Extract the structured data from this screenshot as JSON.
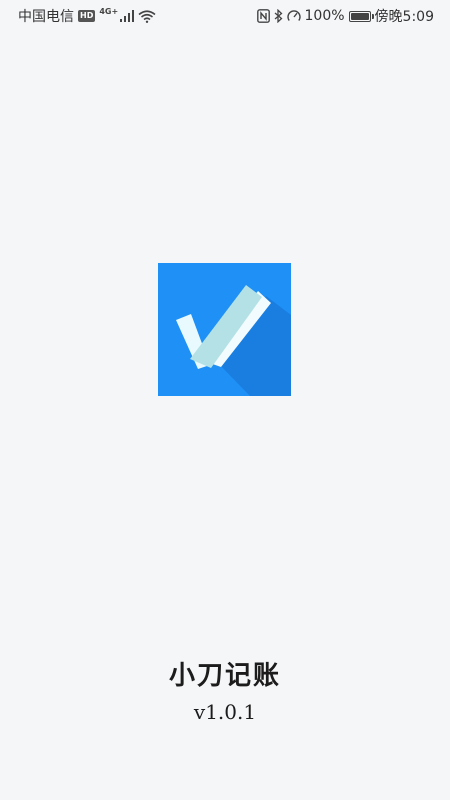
{
  "status_bar": {
    "carrier": "中国电信",
    "hd_badge": "HD",
    "network_type": "4G+",
    "battery_percent": "100%",
    "battery_level": 1.0,
    "time": "傍晚5:09",
    "icons": [
      "hd-icon",
      "signal-icon",
      "wifi-icon",
      "nfc-icon",
      "bluetooth-icon",
      "speed-icon",
      "battery-icon"
    ]
  },
  "splash": {
    "app_name": "小刀记账",
    "version": "v1.0.1",
    "logo_colors": {
      "background": "#1e90f6",
      "shadow": "#1a7ee0",
      "check_light": "#e8fafe",
      "check_main": "#b3e1e6"
    }
  }
}
